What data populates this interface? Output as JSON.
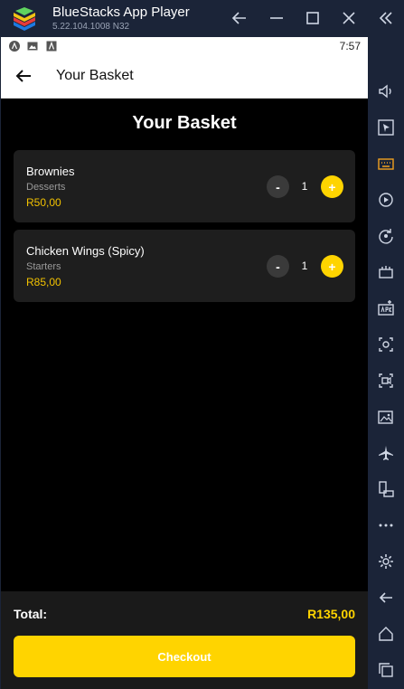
{
  "window": {
    "title": "BlueStacks App Player",
    "version": "5.22.104.1008  N32"
  },
  "statusbar": {
    "time": "7:57"
  },
  "appbar": {
    "title": "Your Basket"
  },
  "page": {
    "heading": "Your Basket"
  },
  "basket": {
    "items": [
      {
        "name": "Brownies",
        "category": "Desserts",
        "price": "R50,00",
        "quantity": "1",
        "minus_label": "-",
        "plus_label": "+"
      },
      {
        "name": "Chicken Wings (Spicy)",
        "category": "Starters",
        "price": "R85,00",
        "quantity": "1",
        "minus_label": "-",
        "plus_label": "+"
      }
    ]
  },
  "footer": {
    "total_label": "Total:",
    "total_value": "R135,00",
    "checkout_label": "Checkout"
  },
  "colors": {
    "accent": "#ffd400",
    "price": "#f2c200",
    "card_bg": "#1e1e1e",
    "chrome_bg": "#1b2438"
  },
  "sidebar_icons": [
    "double-chevron-left-icon",
    "volume-icon",
    "pointer-icon",
    "keyboard-icon",
    "macro-play-icon",
    "rotate-icon",
    "multi-instance-icon",
    "apk-install-icon",
    "screenshot-icon",
    "screen-record-icon",
    "media-folder-icon",
    "airplane-icon",
    "resize-icon",
    "more-icon",
    "settings-icon",
    "back-icon",
    "home-icon",
    "recents-icon"
  ]
}
